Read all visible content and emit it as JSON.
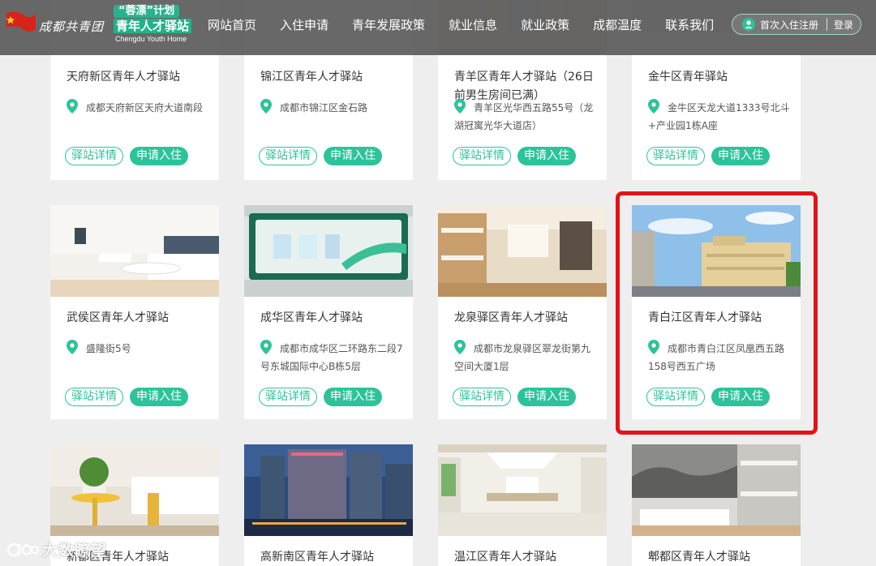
{
  "header": {
    "org_name": "成都共青团",
    "plan_badge": "“蓉漂”计划",
    "site_title": "青年人才驿站",
    "site_subtitle": "Chengdu Youth Home",
    "nav": [
      "网站首页",
      "入住申请",
      "青年发展政策",
      "就业信息",
      "就业政策",
      "成都温度",
      "联系我们"
    ],
    "register_label": "首次入住注册",
    "login_label": "登录"
  },
  "buttons": {
    "detail": "驿站详情",
    "apply": "申请入住"
  },
  "cards": [
    {
      "title": "天府新区青年人才驿站",
      "address": "成都天府新区天府大道南段",
      "image": "room-photo"
    },
    {
      "title": "锦江区青年人才驿站",
      "address": "成都市锦江区金石路",
      "image": "room-photo"
    },
    {
      "title": "青羊区青年人才驿站（26日前男生房间已满）",
      "address": "青羊区光华西五路55号（龙湖冠寓光华大道店）",
      "image": "room-photo"
    },
    {
      "title": "金牛区青年驿站",
      "address": "金牛区天龙大道1333号北斗+产业园1栋A座",
      "image": "room-photo"
    },
    {
      "title": "武侯区青年人才驿站",
      "address": "盛隆街5号",
      "image": "hotel-room-photo"
    },
    {
      "title": "成华区青年人才驿站",
      "address": "成都市成华区二环路东二段7号东城国际中心B栋5层",
      "image": "exhibition-hall-photo"
    },
    {
      "title": "龙泉驿区青年人才驿站",
      "address": "成都市龙泉驿区翠龙街第九空间大厦1层",
      "image": "bunk-room-photo"
    },
    {
      "title": "青白江区青年人才驿站",
      "address": "成都市青白江区凤凰西五路158号西五广场",
      "image": "building-street-photo"
    },
    {
      "title": "新都区青年人才驿站",
      "address": "",
      "image": "study-room-photo"
    },
    {
      "title": "高新南区青年人才驿站",
      "address": "",
      "image": "night-building-photo"
    },
    {
      "title": "温江区青年人才驿站",
      "address": "",
      "image": "lobby-photo"
    },
    {
      "title": "郫都区青年人才驿站",
      "address": "",
      "image": "dorm-photo"
    }
  ],
  "watermark": "大数瞭望",
  "colors": {
    "accent": "#2dc39a",
    "highlight": "#e51216",
    "header_bg": "#5c5c5c"
  }
}
